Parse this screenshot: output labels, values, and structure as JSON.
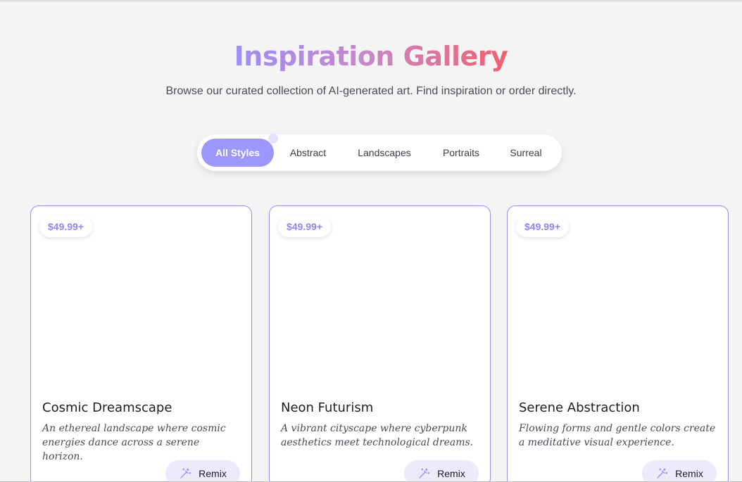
{
  "header": {
    "title": "Inspiration Gallery",
    "subtitle": "Browse our curated collection of AI-generated art. Find inspiration or order directly."
  },
  "filters": {
    "active": "All Styles",
    "items": [
      {
        "label": "All Styles"
      },
      {
        "label": "Abstract"
      },
      {
        "label": "Landscapes"
      },
      {
        "label": "Portraits"
      },
      {
        "label": "Surreal"
      }
    ]
  },
  "cards": [
    {
      "price": "$49.99+",
      "title": "Cosmic Dreamscape",
      "description": "An ethereal landscape where cosmic energies dance across a serene horizon.",
      "action_label": "Remix",
      "action_icon": "magic-wand-icon"
    },
    {
      "price": "$49.99+",
      "title": "Neon Futurism",
      "description": "A vibrant cityscape where cyberpunk aesthetics meet technological dreams.",
      "action_label": "Remix",
      "action_icon": "magic-wand-icon"
    },
    {
      "price": "$49.99+",
      "title": "Serene Abstraction",
      "description": "Flowing forms and gentle colors create a meditative visual experience.",
      "action_label": "Remix",
      "action_icon": "magic-wand-icon"
    }
  ],
  "colors": {
    "accent": "#9d96fb",
    "title_gradient_start": "#9c8ff5",
    "title_gradient_end": "#f25f6d",
    "card_border": "#9c90ee",
    "background": "#f4f4f5"
  }
}
